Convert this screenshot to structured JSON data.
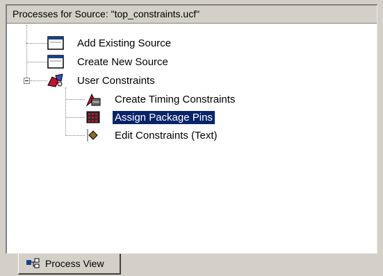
{
  "header": {
    "title": "Processes for Source: \"top_constraints.ucf\""
  },
  "tree": {
    "items": [
      {
        "label": "Add Existing Source",
        "icon": "window-icon"
      },
      {
        "label": "Create New Source",
        "icon": "window-icon"
      },
      {
        "label": "User Constraints",
        "icon": "constraints-icon",
        "expanded": true
      },
      {
        "label": "Create Timing Constraints",
        "icon": "timing-icon"
      },
      {
        "label": "Assign Package Pins",
        "icon": "package-pins-icon",
        "selected": true
      },
      {
        "label": "Edit Constraints (Text)",
        "icon": "edit-constraints-icon"
      }
    ]
  },
  "tabs": [
    {
      "label": "Process View",
      "icon": "process-view-icon",
      "active": true
    }
  ],
  "colors": {
    "selection": "#0a246a",
    "panel": "#d4d0c8"
  }
}
